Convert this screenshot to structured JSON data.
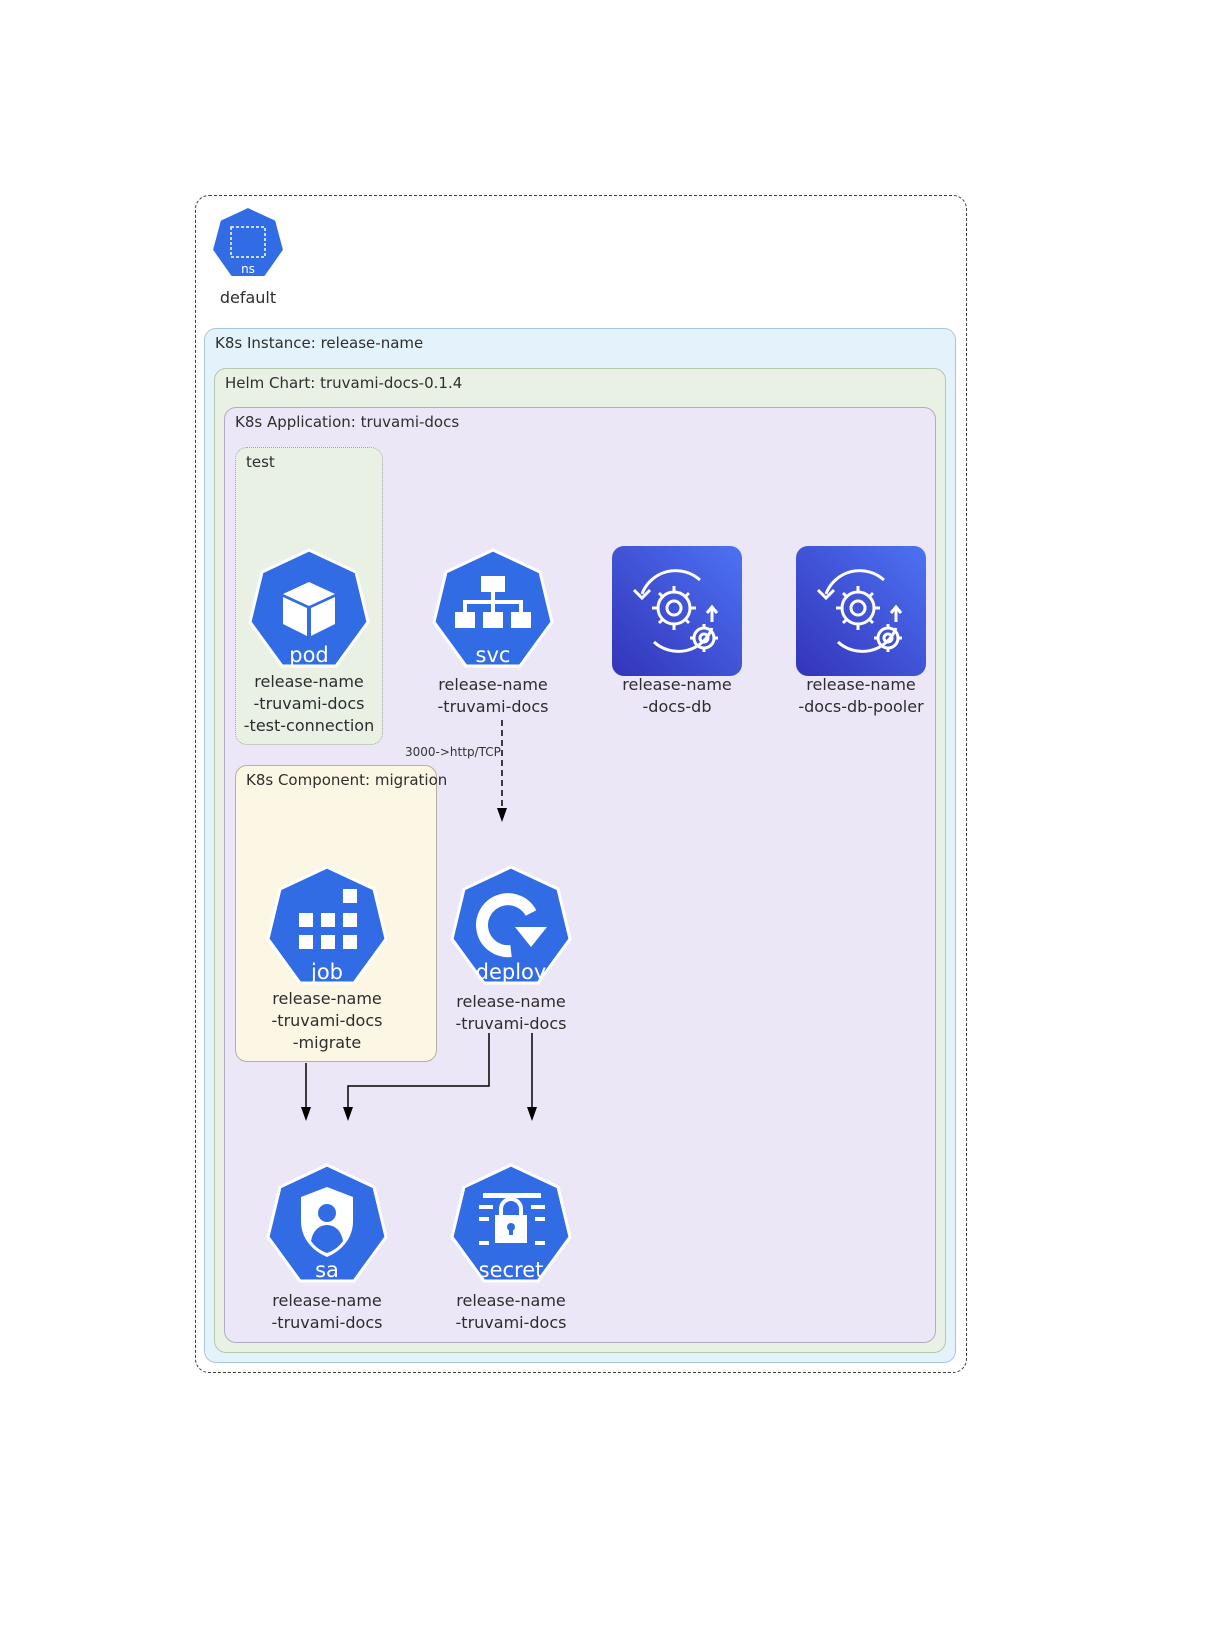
{
  "namespace": {
    "icon_label": "ns",
    "name": "default"
  },
  "clusters": {
    "instance": "K8s Instance: release-name",
    "helm_chart": "Helm Chart: truvami-docs-0.1.4",
    "application": "K8s Application: truvami-docs",
    "test": "test",
    "component": "K8s Component: migration"
  },
  "nodes": {
    "pod": {
      "kind": "pod",
      "icon": "cube-icon",
      "lines": [
        "release-name",
        "-truvami-docs",
        "-test-connection"
      ]
    },
    "svc": {
      "kind": "svc",
      "icon": "network-tree-icon",
      "lines": [
        "release-name",
        "-truvami-docs"
      ]
    },
    "docs_db": {
      "icon": "gears-cycle-icon",
      "lines": [
        "release-name",
        "-docs-db"
      ]
    },
    "docs_db_pooler": {
      "icon": "gears-cycle-icon",
      "lines": [
        "release-name",
        "-docs-db-pooler"
      ]
    },
    "job": {
      "kind": "job",
      "icon": "grid-blocks-icon",
      "lines": [
        "release-name",
        "-truvami-docs",
        "-migrate"
      ]
    },
    "deploy": {
      "kind": "deploy",
      "icon": "refresh-arrow-icon",
      "lines": [
        "release-name",
        "-truvami-docs"
      ]
    },
    "sa": {
      "kind": "sa",
      "icon": "user-shield-icon",
      "lines": [
        "release-name",
        "-truvami-docs"
      ]
    },
    "secret": {
      "kind": "secret",
      "icon": "lock-icon",
      "lines": [
        "release-name",
        "-truvami-docs"
      ]
    }
  },
  "edges": {
    "svc_to_deploy_label": "3000->http/TCP"
  },
  "colors": {
    "k8s_blue": "#326ce5",
    "aws_gradient_top": "#4d72f3",
    "aws_gradient_bottom": "#3334b9",
    "instance_bg": "#e4f3fb",
    "helm_bg": "#e8f1e4",
    "app_bg": "#ece7f6",
    "test_bg": "#e8f1e4",
    "component_bg": "#fcf6e4"
  }
}
